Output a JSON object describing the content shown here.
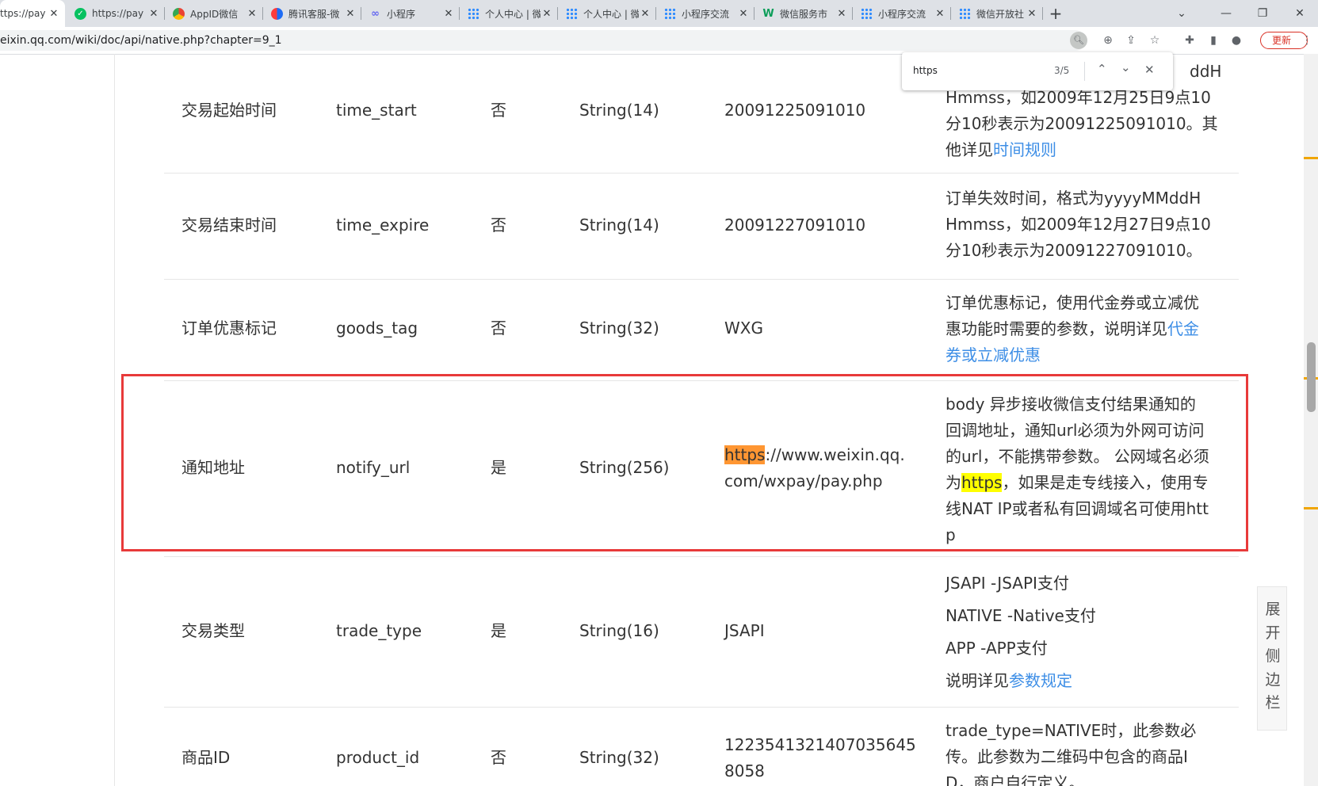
{
  "tabs": [
    {
      "title": "ttps://pay",
      "active": true,
      "icon": "wechat-pay-icon"
    },
    {
      "title": "https://pay",
      "icon": "wechat-icon"
    },
    {
      "title": "AppID微信",
      "icon": "chrome-icon"
    },
    {
      "title": "腾讯客服-微",
      "icon": "tencent-icon"
    },
    {
      "title": "小程序",
      "icon": "miniprogram-icon"
    },
    {
      "title": "个人中心 | 微",
      "icon": "grid-app-icon"
    },
    {
      "title": "个人中心 | 微",
      "icon": "grid-app-icon"
    },
    {
      "title": "小程序交流",
      "icon": "grid-app-icon"
    },
    {
      "title": "微信服务市",
      "icon": "wechat-service-icon"
    },
    {
      "title": "小程序交流",
      "icon": "grid-app-icon"
    },
    {
      "title": "微信开放社",
      "icon": "grid-app-icon"
    }
  ],
  "toolbar": {
    "url": "eixin.qq.com/wiki/doc/api/native.php?chapter=9_1",
    "update_label": "更新"
  },
  "find": {
    "query": "https",
    "count": "3/5"
  },
  "rows": [
    {
      "name": "交易起始时间",
      "field": "time_start",
      "required": "否",
      "type": "String(14)",
      "example": "20091225091010",
      "desc_lines": [
        [
          "ddH",
          ""
        ],
        [
          "Hmmss，如2009年12月25日9点10",
          ""
        ],
        [
          "分10秒表示为20091225091010。其",
          ""
        ],
        [
          "他详见",
          "时间规则"
        ]
      ]
    },
    {
      "name": "交易结束时间",
      "field": "time_expire",
      "required": "否",
      "type": "String(14)",
      "example": "20091227091010",
      "desc_lines": [
        [
          "订单失效时间，格式为yyyyMMddH",
          ""
        ],
        [
          "Hmmss，如2009年12月27日9点10",
          ""
        ],
        [
          "分10秒表示为20091227091010。",
          ""
        ]
      ]
    },
    {
      "name": "订单优惠标记",
      "field": "goods_tag",
      "required": "否",
      "type": "String(32)",
      "example": "WXG",
      "desc_lines": [
        [
          "订单优惠标记，使用代金券或立减优",
          ""
        ],
        [
          "惠功能时需要的参数，说明详见",
          "代金"
        ],
        [
          "",
          "券或立减优惠"
        ]
      ]
    },
    {
      "name": "通知地址",
      "field": "notify_url",
      "required": "是",
      "type": "String(256)",
      "example_hl": "https",
      "example_rest1": "://www.weixin.qq.",
      "example_line2": "com/wxpay/pay.php",
      "desc_lines": [
        [
          "body 异步接收微信支付结果通知的",
          ""
        ],
        [
          "回调地址，通知url必须为外网可访问",
          ""
        ],
        [
          "的url，不能携带参数。 公网域名必须",
          ""
        ]
      ],
      "desc_hl_pre": "为",
      "desc_hl": "https",
      "desc_hl_post": "，如果是走专线接入，使用专",
      "desc_tail": [
        "线NAT IP或者私有回调域名可使用htt",
        "p"
      ]
    },
    {
      "name": "交易类型",
      "field": "trade_type",
      "required": "是",
      "type": "String(16)",
      "example": "JSAPI",
      "desc_lines": [
        [
          "JSAPI -JSAPI支付",
          ""
        ],
        [
          "NATIVE -Native支付",
          ""
        ],
        [
          "APP -APP支付",
          ""
        ],
        [
          "说明详见",
          "参数规定"
        ]
      ]
    },
    {
      "name": "商品ID",
      "field": "product_id",
      "required": "否",
      "type": "String(32)",
      "example_line1": "1223541321407035645",
      "example_line2": "8058",
      "desc_lines": [
        [
          "trade_type=NATIVE时，此参数必",
          ""
        ],
        [
          "传。此参数为二维码中包含的商品I",
          ""
        ],
        [
          "D，商户自行定义。",
          ""
        ]
      ]
    }
  ],
  "side_toggle": [
    "展",
    "开",
    "侧",
    "边",
    "栏"
  ]
}
